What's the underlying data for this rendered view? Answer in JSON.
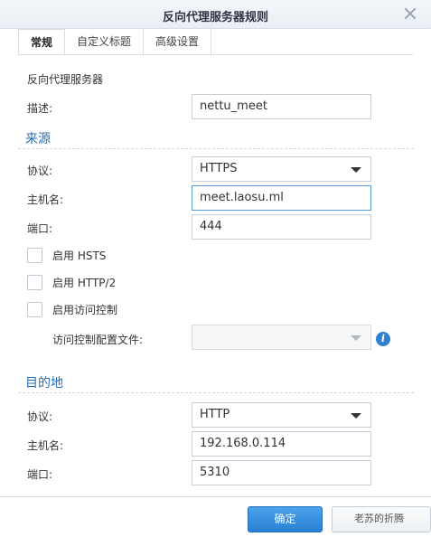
{
  "dialog": {
    "title": "反向代理服务器规则"
  },
  "tabs": [
    {
      "label": "常规"
    },
    {
      "label": "自定义标题"
    },
    {
      "label": "高级设置"
    }
  ],
  "general": {
    "heading": "反向代理服务器",
    "description_label": "描述:",
    "description_value": "nettu_meet"
  },
  "source": {
    "heading": "来源",
    "protocol_label": "协议:",
    "protocol_value": "HTTPS",
    "hostname_label": "主机名:",
    "hostname_value": "meet.laosu.ml",
    "port_label": "端口:",
    "port_value": "444",
    "hsts_label": "启用 HSTS",
    "http2_label": "启用 HTTP/2",
    "access_control_label": "启用访问控制",
    "access_profile_label": "访问控制配置文件:",
    "access_profile_value": ""
  },
  "destination": {
    "heading": "目的地",
    "protocol_label": "协议:",
    "protocol_value": "HTTP",
    "hostname_label": "主机名:",
    "hostname_value": "192.168.0.114",
    "port_label": "端口:",
    "port_value": "5310"
  },
  "footer": {
    "ok_label": "确定",
    "watermark": "老苏的折腾"
  },
  "colors": {
    "accent": "#2a7fd4",
    "section": "#2a6cb3",
    "info": "#2f80d1"
  },
  "icons": {
    "close": "close-icon",
    "info": "info-icon",
    "dropdown": "chevron-down-icon"
  }
}
